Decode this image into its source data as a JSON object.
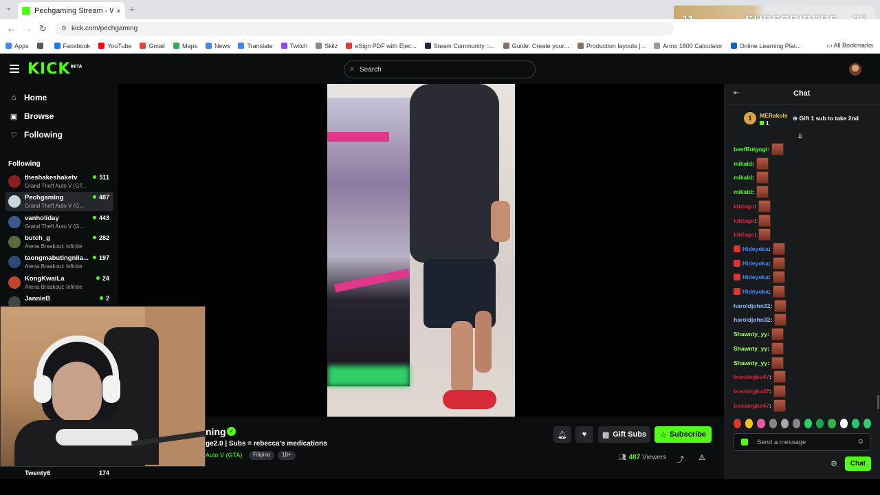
{
  "browser": {
    "tab_title": "Pechgaming Stream - Watch...",
    "url": "kick.com/pechgaming",
    "bookmarks": [
      {
        "label": "Apps",
        "color": "#4285f4"
      },
      {
        "label": "",
        "color": "#555555"
      },
      {
        "label": "Facebook",
        "color": "#1877f2"
      },
      {
        "label": "YouTube",
        "color": "#ff0000"
      },
      {
        "label": "Gmail",
        "color": "#ea4335"
      },
      {
        "label": "Maps",
        "color": "#34a853"
      },
      {
        "label": "News",
        "color": "#4285f4"
      },
      {
        "label": "Translate",
        "color": "#4285f4"
      },
      {
        "label": "Twitch",
        "color": "#9146ff"
      },
      {
        "label": "Skilz",
        "color": "#888888"
      },
      {
        "label": "eSign PDF with Elec...",
        "color": "#e53935"
      },
      {
        "label": "Steam Community ::...",
        "color": "#1b2838"
      },
      {
        "label": "Guide: Create your...",
        "color": "#8d6e63"
      },
      {
        "label": "Production layouts |...",
        "color": "#8d6e63"
      },
      {
        "label": "Anno 1800 Calculator",
        "color": "#999999"
      },
      {
        "label": "Online Learning Plat...",
        "color": "#1565c0"
      }
    ],
    "all_bookmarks": "All Bookmarks"
  },
  "overlay": {
    "left": "11",
    "middle": "SUBSCRIBERS",
    "right": "25"
  },
  "header": {
    "logo": "KICK",
    "logo_beta": "BETA",
    "search_placeholder": "Search"
  },
  "nav": {
    "home": "Home",
    "browse": "Browse",
    "following": "Following"
  },
  "following_heading": "Following",
  "channels": [
    {
      "name": "theshakeshaketv",
      "game": "Grand Theft Auto V (GT...",
      "viewers": "511",
      "color": "#8b1f1f"
    },
    {
      "name": "Pechgaming",
      "game": "Grand Theft Auto V (G...",
      "viewers": "487",
      "color": "#c9d6e0"
    },
    {
      "name": "vanholiday",
      "game": "Grand Theft Auto V (G...",
      "viewers": "443",
      "color": "#3a5a8c"
    },
    {
      "name": "butch_g",
      "game": "Arena Breakout: Infinite",
      "viewers": "282",
      "color": "#5a6b3a"
    },
    {
      "name": "taongmabutingnila...",
      "game": "Arena Breakout: Infinite",
      "viewers": "197",
      "color": "#2b4a7a"
    },
    {
      "name": "KongKwaiLa",
      "game": "Arena Breakout: Infinite",
      "viewers": "24",
      "color": "#c2452f"
    },
    {
      "name": "JannieB",
      "game": "",
      "viewers": "2",
      "color": "#444444"
    }
  ],
  "bottom_channel": {
    "name": "Twenty6",
    "viewers": "174"
  },
  "stream": {
    "title": "ning",
    "subtitle": "ge2.0 | Subs = rebecca's medications",
    "game": "Auto V (GTA)",
    "tags": [
      "Filipino",
      "18+"
    ],
    "gift_label": "Gift Subs",
    "subscribe_label": "Subscribe",
    "viewers": "487",
    "viewers_label": "Viewers"
  },
  "chat": {
    "title": "Chat",
    "pinned": {
      "rank": "1",
      "name": "MERakols",
      "count": "1",
      "gift_text": "Gift 1 sub to take 2nd"
    },
    "messages": [
      {
        "user": "beefBulgogi",
        "color": "#53fc18",
        "badge": false
      },
      {
        "user": "mikald",
        "color": "#53fc18",
        "badge": false
      },
      {
        "user": "mikald",
        "color": "#53fc18",
        "badge": false
      },
      {
        "user": "mikald",
        "color": "#53fc18",
        "badge": false
      },
      {
        "user": "kitdago",
        "color": "#e0203a",
        "badge": false
      },
      {
        "user": "kitdago",
        "color": "#e0203a",
        "badge": false
      },
      {
        "user": "kitdago",
        "color": "#e0203a",
        "badge": false
      },
      {
        "user": "Hideyoka",
        "color": "#3d8bff",
        "badge": true
      },
      {
        "user": "Hideyoka",
        "color": "#3d8bff",
        "badge": true
      },
      {
        "user": "Hideyoka",
        "color": "#3d8bff",
        "badge": true
      },
      {
        "user": "Hideyoka",
        "color": "#3d8bff",
        "badge": true
      },
      {
        "user": "haroldjohn32",
        "color": "#8fb8ff",
        "badge": false
      },
      {
        "user": "haroldjohn32",
        "color": "#8fb8ff",
        "badge": false
      },
      {
        "user": "Shawnty_yy",
        "color": "#a6ff5a",
        "badge": false
      },
      {
        "user": "Shawnty_yy",
        "color": "#a6ff5a",
        "badge": false
      },
      {
        "user": "Shawnty_yy",
        "color": "#a6ff5a",
        "badge": false
      },
      {
        "user": "bossingko47",
        "color": "#e0203a",
        "badge": false
      },
      {
        "user": "bossingko47",
        "color": "#e0203a",
        "badge": false
      },
      {
        "user": "bossingko47",
        "color": "#e0203a",
        "badge": false
      }
    ],
    "emote_colors": [
      "#e0352b",
      "#f2c21b",
      "#e65c9a",
      "#888888",
      "#aaaaaa",
      "#888888",
      "#2fcf6a",
      "#1fa34a",
      "#31b24f",
      "#ffffff",
      "#26c47a",
      "#2fcf6a"
    ],
    "input_placeholder": "Send a message",
    "send_label": "Chat"
  },
  "colors": {
    "brand": "#53fc18",
    "bg": "#0b0e0f",
    "chat_bg": "#181b1e"
  }
}
